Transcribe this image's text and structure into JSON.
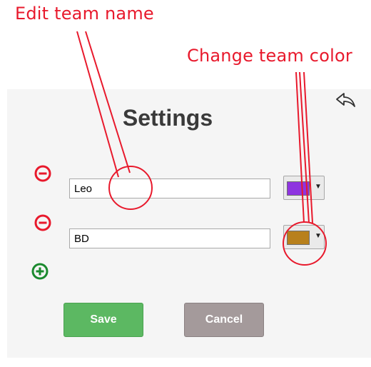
{
  "annotations": {
    "edit_team_name": "Edit team name",
    "change_team_color": "Change team color"
  },
  "settings": {
    "title": "Settings",
    "back_icon": "back-arrow-icon",
    "teams": [
      {
        "name": "Leo",
        "color": "#8e34e0",
        "remove_icon": "minus-circle-icon"
      },
      {
        "name": "BD",
        "color": "#b8801c",
        "remove_icon": "minus-circle-icon"
      }
    ],
    "add_icon": "plus-circle-icon",
    "save_label": "Save",
    "cancel_label": "Cancel"
  },
  "colors": {
    "annotation": "#e8192c",
    "remove": "#e8192c",
    "add": "#1a8a2e",
    "save": "#5cb862",
    "cancel": "#a49a9b",
    "panel_bg": "#f5f5f5"
  }
}
